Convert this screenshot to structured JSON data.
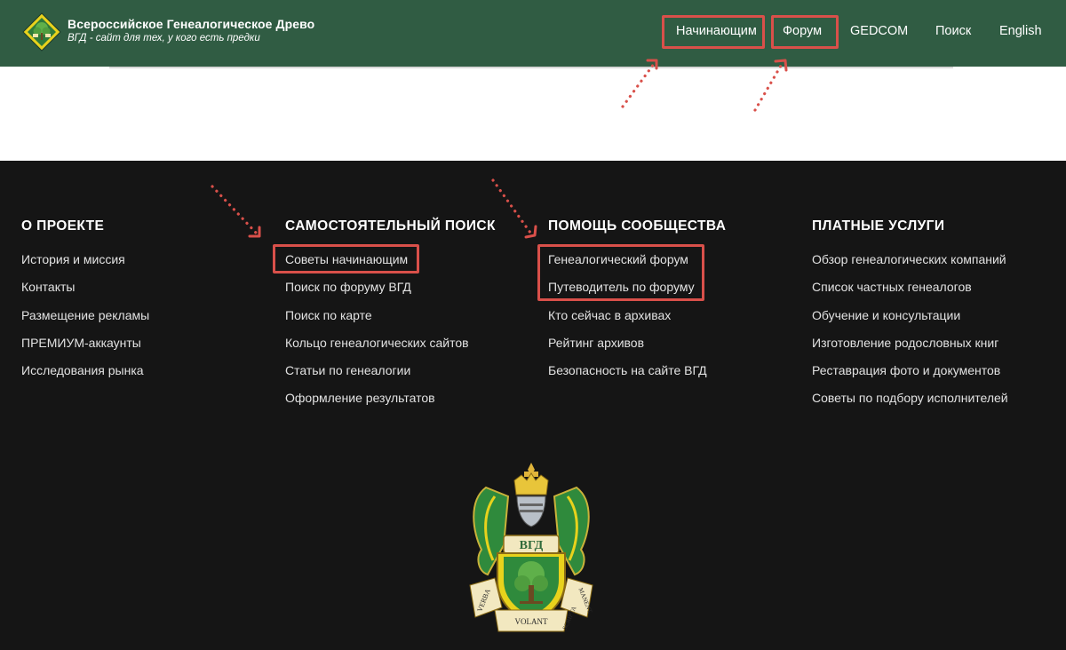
{
  "header": {
    "title": "Всероссийское Генеалогическое Древо",
    "tagline": "ВГД - сайт для тех, у кого есть предки",
    "logo_icon": "tree-diamond-logo-icon",
    "nav": [
      {
        "label": "Начинающим",
        "highlighted": true
      },
      {
        "label": "Форум",
        "highlighted": true
      },
      {
        "label": "GEDCOM",
        "highlighted": false
      },
      {
        "label": "Поиск",
        "highlighted": false
      },
      {
        "label": "English",
        "highlighted": false
      }
    ]
  },
  "footer": {
    "columns": [
      {
        "heading": "О ПРОЕКТЕ",
        "items": [
          "История и миссия",
          "Контакты",
          "Размещение рекламы",
          "ПРЕМИУМ-аккаунты",
          "Исследования рынка"
        ]
      },
      {
        "heading": "САМОСТОЯТЕЛЬНЫЙ ПОИСК",
        "items": [
          "Советы начинающим",
          "Поиск по форуму ВГД",
          "Поиск по карте",
          "Кольцо генеалогических сайтов",
          "Статьи по генеалогии",
          "Оформление результатов"
        ]
      },
      {
        "heading": "ПОМОЩЬ СООБЩЕСТВА",
        "items": [
          "Генеалогический форум",
          "Путеводитель по форуму",
          "Кто сейчас в архивах",
          "Рейтинг архивов",
          "Безопасность на сайте ВГД"
        ]
      },
      {
        "heading": "ПЛАТНЫЕ УСЛУГИ",
        "items": [
          "Обзор генеалогических компаний",
          "Список частных генеалогов",
          "Обучение и консультации",
          "Изготовление родословных книг",
          "Реставрация фото и документов",
          "Советы по подбору исполнителей"
        ]
      }
    ],
    "emblem": {
      "shield_text": "ВГД",
      "motto_left": "VERBA",
      "motto_center": "VOLANT",
      "motto_right1": "SCRIPTA",
      "motto_right2": "MANENT"
    }
  },
  "annotations": {
    "highlight_color": "#d9504a",
    "header_green": "#305c43",
    "footer_bg": "#151515"
  }
}
